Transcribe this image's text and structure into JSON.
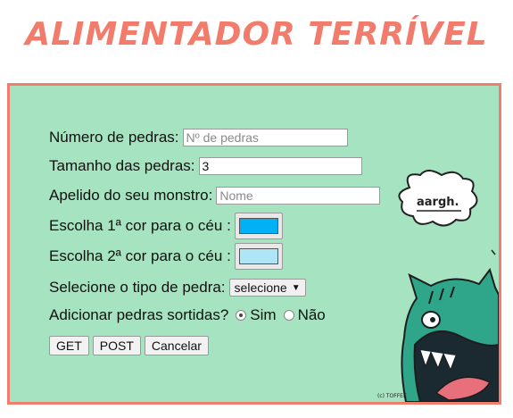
{
  "header": {
    "title": "ALIMENTADOR TERRÍVEL"
  },
  "form": {
    "num_pedras": {
      "label": "Número de pedras:",
      "placeholder": "Nº de pedras",
      "value": ""
    },
    "tamanho": {
      "label": "Tamanho das pedras:",
      "placeholder": "",
      "value": "3"
    },
    "apelido": {
      "label": "Apelido do seu monstro:",
      "placeholder": "Nome",
      "value": ""
    },
    "cor1": {
      "label": "Escolha 1ª cor para o céu :",
      "color": "#00b2f5"
    },
    "cor2": {
      "label": "Escolha 2ª cor para o céu :",
      "color": "#aee6f7"
    },
    "tipo": {
      "label": "Selecione o tipo de pedra:",
      "selected": "selecione"
    },
    "sortidas": {
      "label": "Adicionar pedras sortidas?",
      "options": [
        "Sim",
        "Não"
      ],
      "selected": "Sim"
    },
    "buttons": {
      "get": "GET",
      "post": "POST",
      "cancel": "Cancelar"
    }
  },
  "art": {
    "speech": "aargh.",
    "credit": "(c) TOFFEE"
  },
  "colors": {
    "title": "#f27c6b",
    "frame_border": "#f07d6e",
    "frame_bg": "#a6e3c1",
    "monster": "#2fa68a"
  }
}
